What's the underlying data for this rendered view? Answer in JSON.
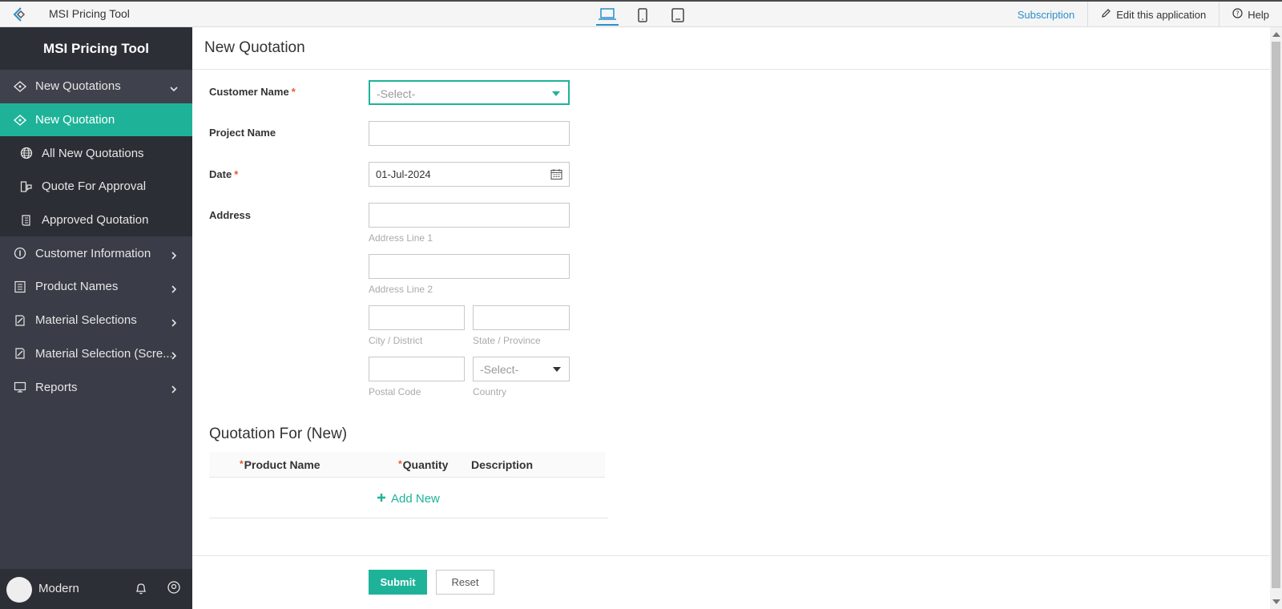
{
  "topbar": {
    "app_name": "MSI Pricing Tool",
    "subscription": "Subscription",
    "edit_app": "Edit this application",
    "help": "Help"
  },
  "sidebar": {
    "brand": "MSI Pricing Tool",
    "items": [
      {
        "label": "New Quotations",
        "icon": "quote-icon",
        "type": "group-open"
      },
      {
        "label": "New Quotation",
        "icon": "quote-icon",
        "type": "active"
      },
      {
        "label": "All New Quotations",
        "icon": "globe-icon",
        "type": "sub"
      },
      {
        "label": "Quote For Approval",
        "icon": "approval-icon",
        "type": "sub"
      },
      {
        "label": "Approved Quotation",
        "icon": "scroll-icon",
        "type": "sub"
      },
      {
        "label": "Customer Information",
        "icon": "info-icon",
        "type": "group"
      },
      {
        "label": "Product Names",
        "icon": "list-icon",
        "type": "group"
      },
      {
        "label": "Material Selections",
        "icon": "edit-doc-icon",
        "type": "group"
      },
      {
        "label": "Material Selection (Scre...",
        "icon": "edit-doc-icon",
        "type": "group"
      },
      {
        "label": "Reports",
        "icon": "monitor-icon",
        "type": "group"
      }
    ],
    "user": "Modern"
  },
  "main": {
    "title": "New Quotation",
    "customer_name_label": "Customer Name",
    "customer_name_placeholder": "-Select-",
    "project_name_label": "Project Name",
    "date_label": "Date",
    "date_value": "01-Jul-2024",
    "address_label": "Address",
    "address_line1": "Address Line 1",
    "address_line2": "Address Line 2",
    "city": "City / District",
    "state": "State / Province",
    "postal": "Postal Code",
    "country": "Country",
    "country_placeholder": "-Select-",
    "section_title": "Quotation For (New)",
    "col_product": "Product Name",
    "col_quantity": "Quantity",
    "col_description": "Description",
    "add_new": "Add New",
    "submit": "Submit",
    "reset": "Reset"
  },
  "colors": {
    "accent": "#1eb399",
    "sidebar_bg": "#3a3d47",
    "link": "#2a8fc9",
    "required": "#e85a2a"
  }
}
